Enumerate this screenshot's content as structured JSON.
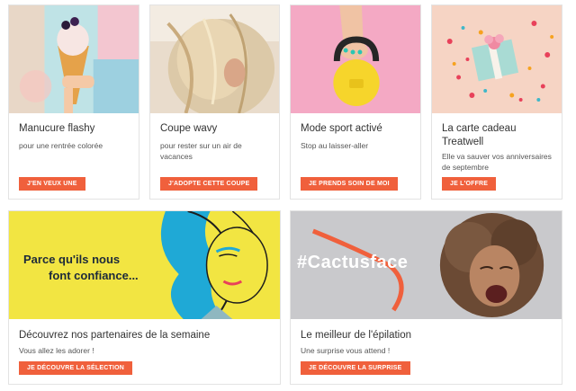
{
  "cards": [
    {
      "title": "Manucure flashy",
      "description": "pour une rentrée colorée",
      "button": "J'EN VEUX UNE"
    },
    {
      "title": "Coupe wavy",
      "description": "pour rester sur un air de vacances",
      "button": "J'ADOPTE CETTE COUPE"
    },
    {
      "title": "Mode sport activé",
      "description": "Stop au laisser-aller",
      "button": "JE PRENDS SOIN DE MOI"
    },
    {
      "title": "La carte cadeau Treatwell",
      "description": "Elle va sauver vos anniversaires de septembre",
      "button": "JE L'OFFRE"
    }
  ],
  "wide_cards": [
    {
      "banner_text_line1": "Parce qu'ils nous",
      "banner_text_line2": "font confiance...",
      "title": "Découvrez nos partenaires de la semaine",
      "description": "Vous allez les adorer !",
      "button": "JE DÉCOUVRE LA SÉLECTION"
    },
    {
      "banner_text": "#Cactusface",
      "title": "Le meilleur de l'épilation",
      "description": "Une surprise vous attend !",
      "button": "JE DÉCOUVRE LA SURPRISE"
    }
  ],
  "colors": {
    "accent": "#f0603c",
    "banner_yellow": "#f2e542",
    "banner_blue": "#1fa9d6",
    "banner_gray": "#c9c9cc"
  }
}
